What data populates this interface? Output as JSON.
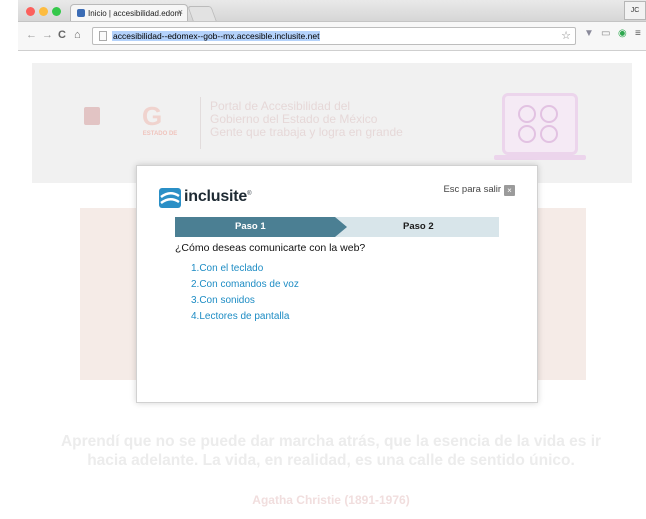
{
  "browser": {
    "tab_title": "Inicio | accesibilidad.edom",
    "tab_close": "×",
    "profile": "JC",
    "url": "accesibilidad--edomex--gob--mx.accesible.inclusite.net",
    "traffic_lights": [
      "#fc605c",
      "#fdbc40",
      "#34c84a"
    ]
  },
  "site": {
    "portal_title_lines": [
      "Portal de Accesibilidad del",
      "Gobierno del Estado de México",
      "Gente que trabaja y logra en grande"
    ],
    "logo_b_letter": "G",
    "logo_b_caption": "ESTADO DE",
    "quote": "Aprendí que no se puede dar marcha atrás, que la esencia de la vida es ir hacia adelante. La vida, en realidad, es una calle de sentido único.",
    "author": "Agatha Christie (1891-1976)"
  },
  "modal": {
    "brand": "inclusite",
    "brand_mark": "®",
    "exit_label": "Esc para salir",
    "exit_icon": "×",
    "steps": [
      "Paso 1",
      "Paso 2"
    ],
    "active_step": 1,
    "question": "¿Cómo deseas comunicarte con la web?",
    "options": [
      "1.Con el teclado",
      "2.Con comandos de voz",
      "3.Con sonidos",
      "4.Lectores de pantalla"
    ],
    "colors": {
      "step_active": "#4b7f93",
      "step_inactive": "#d8e5ea",
      "link": "#1d8cc4"
    }
  }
}
